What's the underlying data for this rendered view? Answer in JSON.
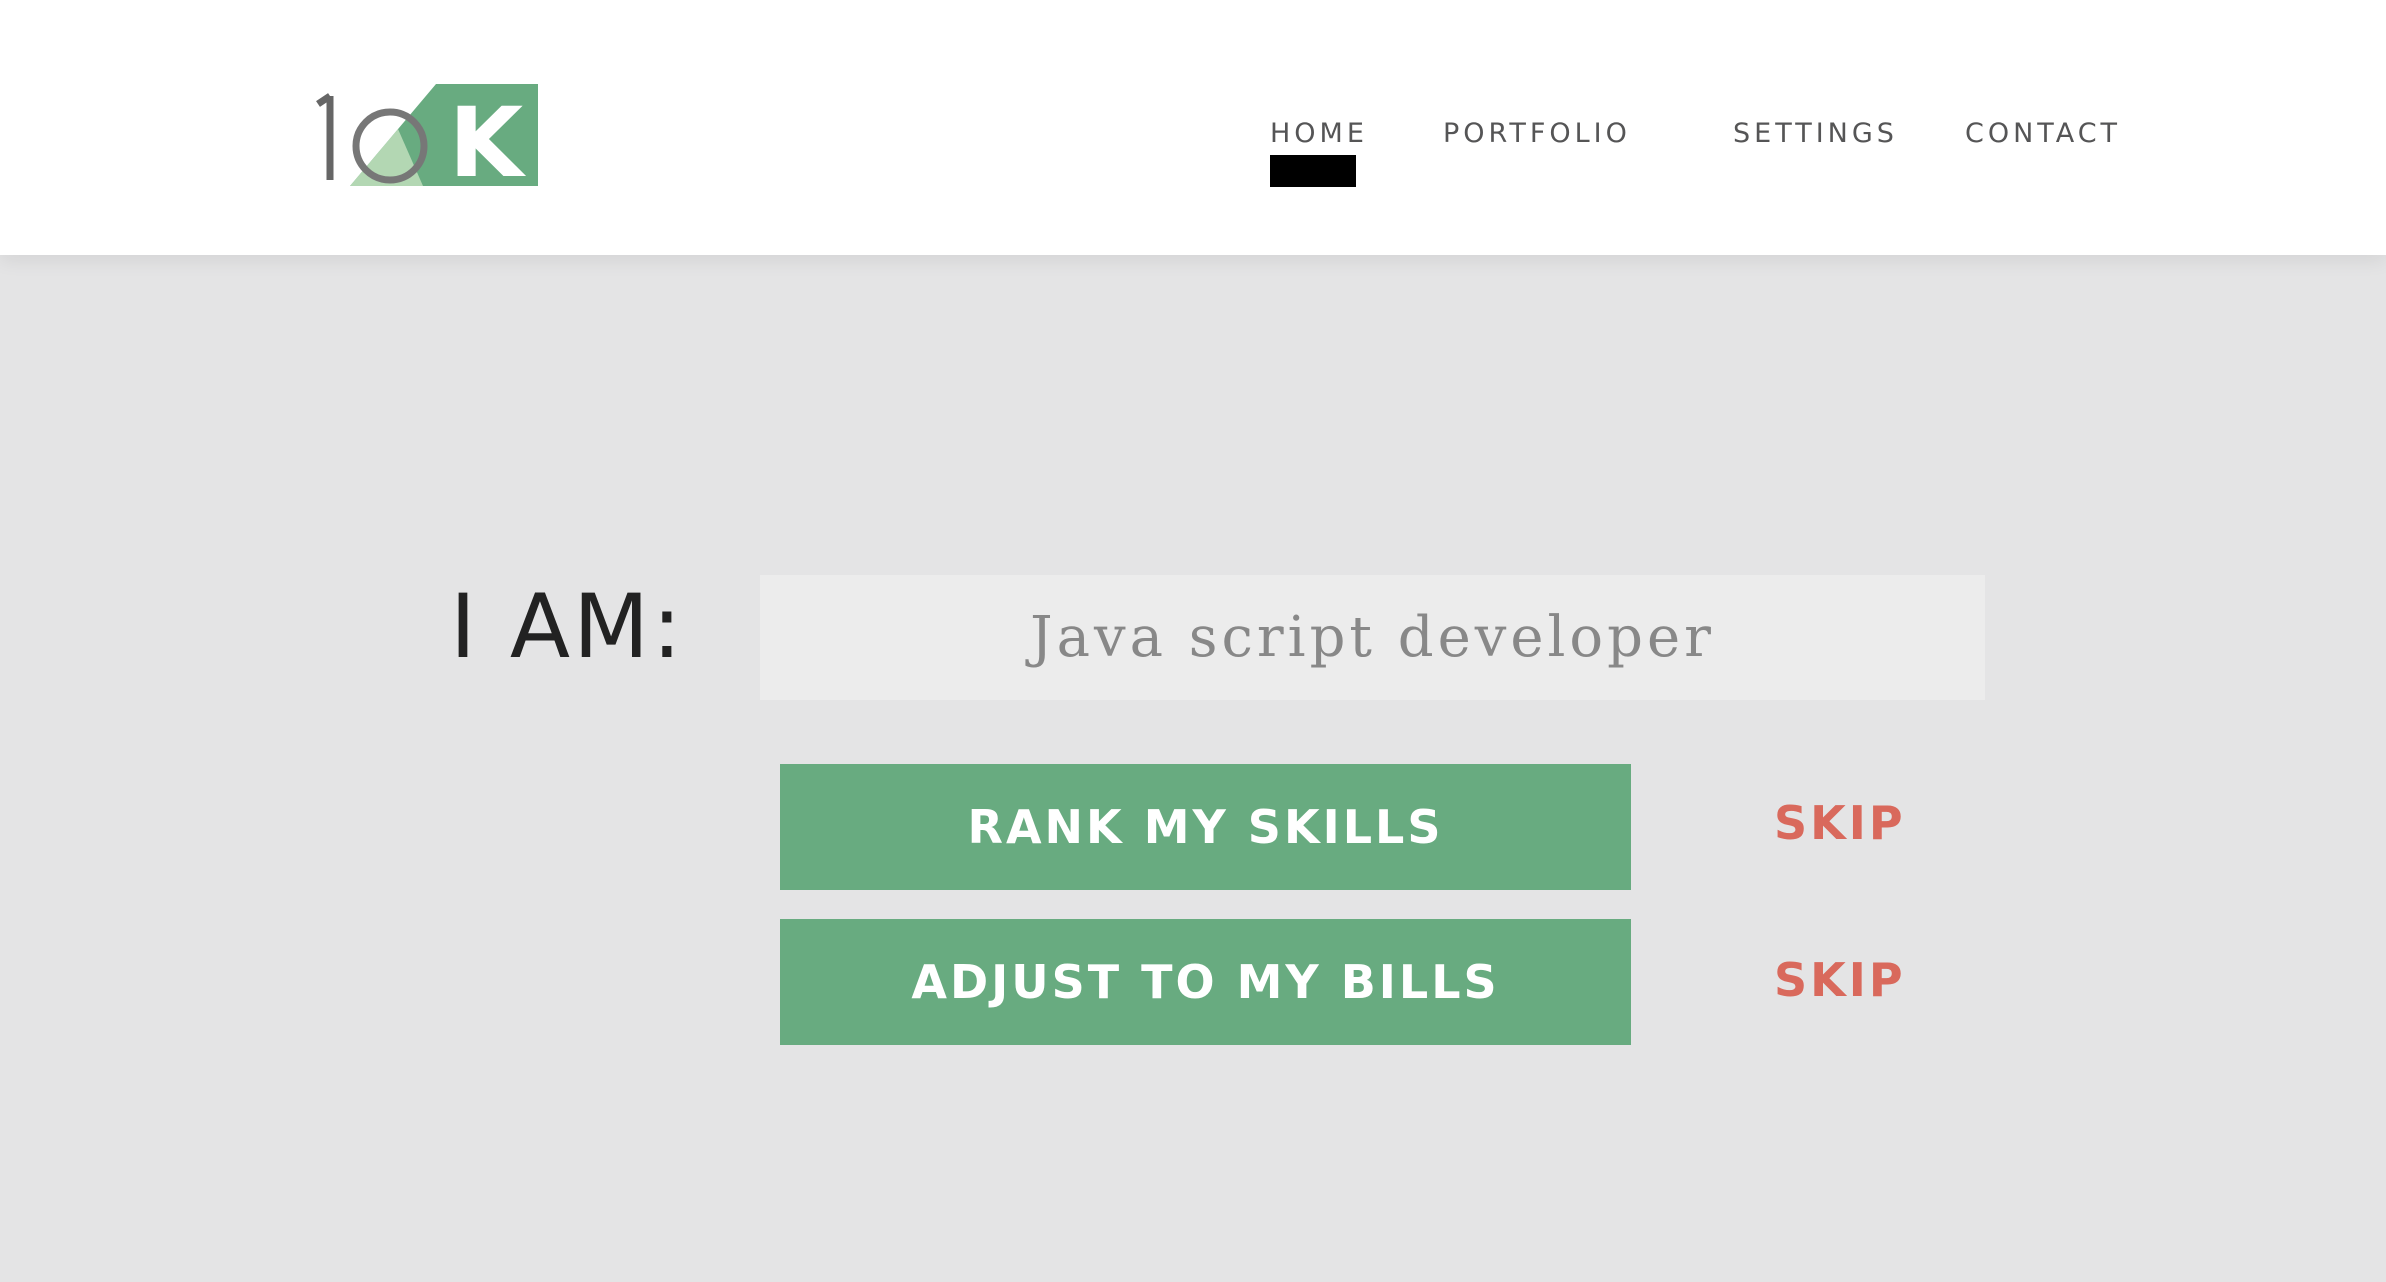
{
  "header": {
    "logo": {
      "digits": "10",
      "letter": "K",
      "colors": {
        "green": "#68ab80",
        "light_green": "#b3d7b3",
        "gray": "#666666"
      }
    },
    "nav": [
      {
        "label": "HOME",
        "active": true
      },
      {
        "label": "PORTFOLIO",
        "active": false
      },
      {
        "label": "SETTINGS",
        "active": false
      },
      {
        "label": "CONTACT",
        "active": false
      }
    ]
  },
  "form": {
    "label": "I AM:",
    "role_value": "Java script developer",
    "rank_button": "RANK MY SKILLS",
    "bills_button": "ADJUST TO MY BILLS",
    "skip_1": "SKIP",
    "skip_2": "SKIP"
  },
  "colors": {
    "accent": "#68ab80",
    "skip": "#d9695c",
    "background": "#e4e4e5"
  }
}
